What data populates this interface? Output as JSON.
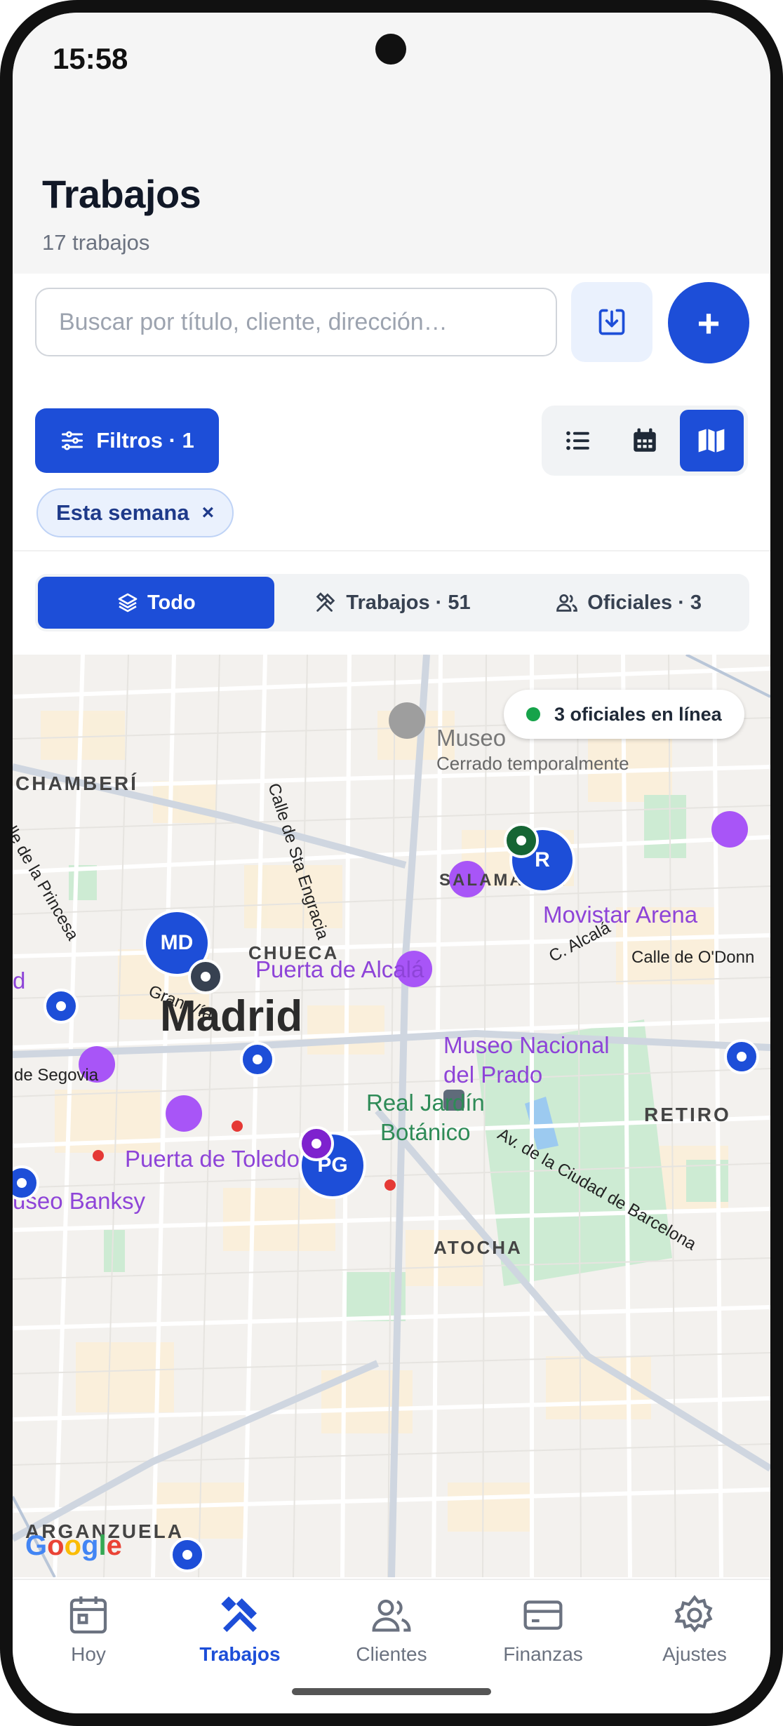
{
  "status_bar": {
    "time": "15:58"
  },
  "header": {
    "title": "Trabajos",
    "subtitle": "17 trabajos"
  },
  "search": {
    "placeholder": "Buscar por título, cliente, dirección…"
  },
  "toolbar": {
    "export_icon": "download-icon",
    "add_label": "+",
    "filters_label": "Filtros · 1",
    "views": [
      {
        "name": "list-icon",
        "active": false
      },
      {
        "name": "calendar-icon",
        "active": false
      },
      {
        "name": "map-icon",
        "active": true
      }
    ]
  },
  "chips": [
    {
      "label": "Esta semana",
      "close": "×"
    }
  ],
  "segments": [
    {
      "label": "Todo",
      "icon": "layers-icon",
      "active": true
    },
    {
      "label": "Trabajos · 51",
      "icon": "tools-icon",
      "active": false
    },
    {
      "label": "Oficiales · 3",
      "icon": "users-icon",
      "active": false
    }
  ],
  "map": {
    "online_badge": "3 oficiales en línea",
    "city": "Madrid",
    "districts": [
      "CHAMBERÍ",
      "SALAMANCA",
      "CHUECA",
      "RETIRO",
      "ATOCHA",
      "ARGANZUELA"
    ],
    "pois": [
      "Museo",
      "Cerrado temporalmente",
      "Movistar Arena",
      "Puerta de Alcalá",
      "Museo Nacional",
      "del Prado",
      "Real Jardín",
      "Botánico",
      "Puerta de Toledo",
      "useo Banksy"
    ],
    "streets": [
      "Calle de Sta Engracia",
      "lle de la Princesa",
      "Gran Vía",
      "C. Alcalá",
      "Calle de O'Donn",
      "de Segovia",
      "Av. de la Ciudad de Barcelona",
      "d"
    ],
    "clusters": [
      "MD",
      "PG",
      "R"
    ],
    "attribution": "Google"
  },
  "nav": [
    {
      "label": "Hoy",
      "icon": "calendar-day-icon",
      "active": false
    },
    {
      "label": "Trabajos",
      "icon": "tools-icon",
      "active": true
    },
    {
      "label": "Clientes",
      "icon": "users-icon",
      "active": false
    },
    {
      "label": "Finanzas",
      "icon": "card-icon",
      "active": false
    },
    {
      "label": "Ajustes",
      "icon": "gear-icon",
      "active": false
    }
  ],
  "colors": {
    "primary": "#1d4ed8",
    "poi": "#8e44d8",
    "online": "#16a34a"
  }
}
